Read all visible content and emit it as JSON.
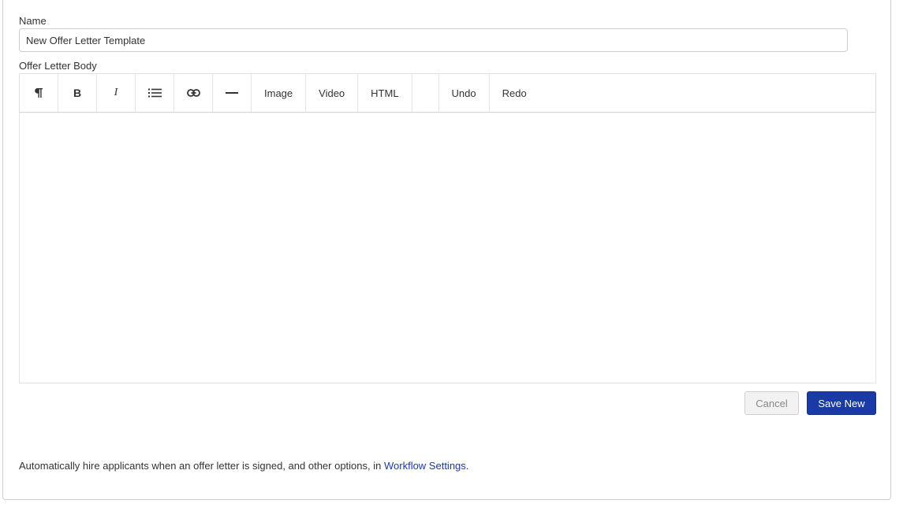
{
  "form": {
    "name_label": "Name",
    "name_value": "New Offer Letter Template",
    "body_label": "Offer Letter Body"
  },
  "toolbar": {
    "paragraph_icon": "paragraph-icon",
    "bold_label": "B",
    "italic_label": "I",
    "list_icon": "list-icon",
    "link_icon": "link-icon",
    "hr_icon": "horizontal-rule-icon",
    "image_label": "Image",
    "video_label": "Video",
    "html_label": "HTML",
    "undo_label": "Undo",
    "redo_label": "Redo"
  },
  "actions": {
    "cancel_label": "Cancel",
    "save_label": "Save New"
  },
  "footer": {
    "text_before": "Automatically hire applicants when an offer letter is signed, and other options, in ",
    "link_text": "Workflow Settings",
    "text_after": "."
  },
  "colors": {
    "primary": "#1a3aa6",
    "link": "#1a3aa6"
  }
}
